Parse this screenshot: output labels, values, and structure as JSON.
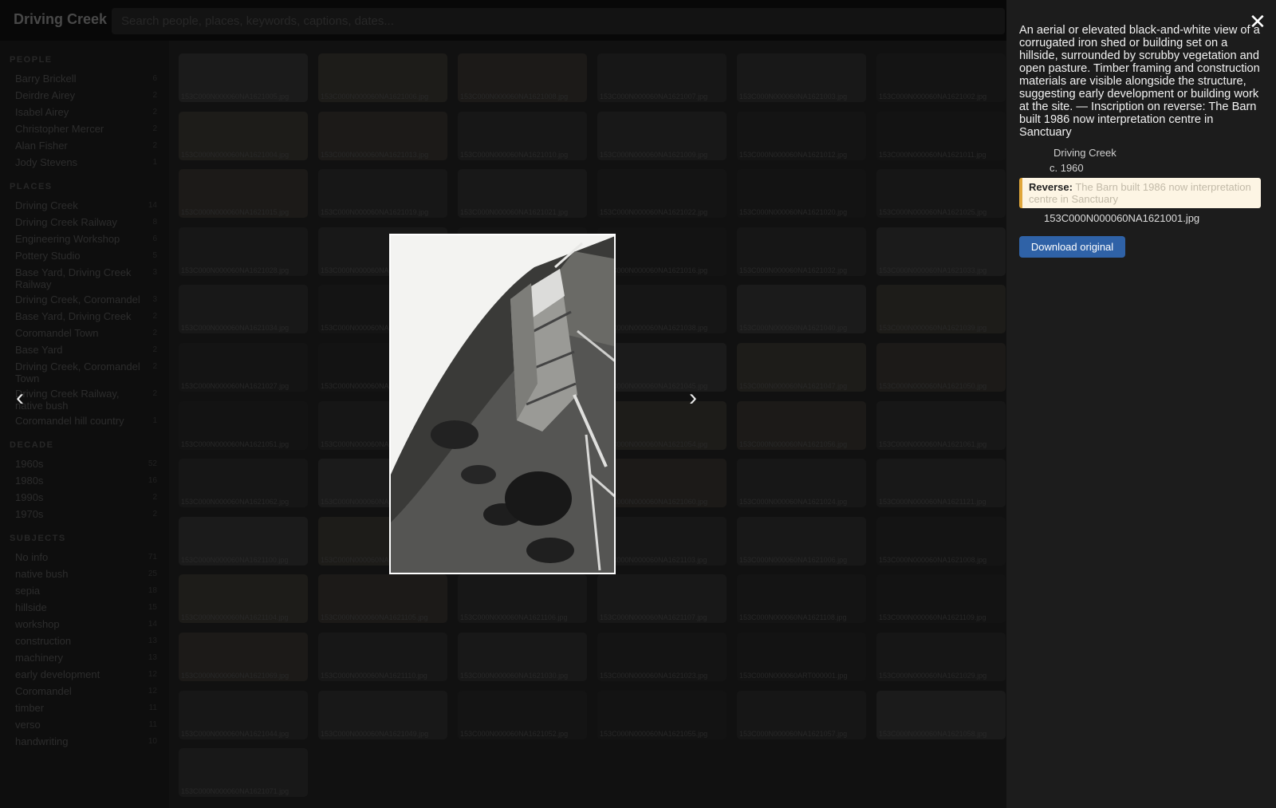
{
  "app": {
    "title": "Driving Creek"
  },
  "search": {
    "placeholder": "Search people, places, keywords, captions, dates..."
  },
  "sidebar": {
    "sections": [
      {
        "heading": "PEOPLE",
        "items": [
          {
            "label": "Barry Brickell",
            "count": "6"
          },
          {
            "label": "Deirdre Airey",
            "count": "2"
          },
          {
            "label": "Isabel Airey",
            "count": "2"
          },
          {
            "label": "Christopher Mercer",
            "count": "2"
          },
          {
            "label": "Alan Fisher",
            "count": "2"
          },
          {
            "label": "Jody Stevens",
            "count": "1"
          }
        ]
      },
      {
        "heading": "PLACES",
        "items": [
          {
            "label": "Driving Creek",
            "count": "14"
          },
          {
            "label": "Driving Creek Railway",
            "count": "8"
          },
          {
            "label": "Engineering Workshop",
            "count": "6"
          },
          {
            "label": "Pottery Studio",
            "count": "5"
          },
          {
            "label": "Base Yard, Driving Creek Railway",
            "count": "3"
          },
          {
            "label": "Driving Creek, Coromandel",
            "count": "3"
          },
          {
            "label": "Base Yard, Driving Creek",
            "count": "2"
          },
          {
            "label": "Coromandel Town",
            "count": "2"
          },
          {
            "label": "Base Yard",
            "count": "2"
          },
          {
            "label": "Driving Creek, Coromandel Town",
            "count": "2"
          },
          {
            "label": "Driving Creek Railway, native bush",
            "count": "2"
          },
          {
            "label": "Coromandel hill country",
            "count": "1"
          }
        ]
      },
      {
        "heading": "DECADE",
        "items": [
          {
            "label": "1960s",
            "count": "52"
          },
          {
            "label": "1980s",
            "count": "16"
          },
          {
            "label": "1990s",
            "count": "2"
          },
          {
            "label": "1970s",
            "count": "2"
          }
        ]
      },
      {
        "heading": "SUBJECTS",
        "items": [
          {
            "label": "No info",
            "count": "71"
          },
          {
            "label": "native bush",
            "count": "25"
          },
          {
            "label": "sepia",
            "count": "18"
          },
          {
            "label": "hillside",
            "count": "15"
          },
          {
            "label": "workshop",
            "count": "14"
          },
          {
            "label": "construction",
            "count": "13"
          },
          {
            "label": "machinery",
            "count": "13"
          },
          {
            "label": "early development",
            "count": "12"
          },
          {
            "label": "Coromandel",
            "count": "12"
          },
          {
            "label": "timber",
            "count": "11"
          },
          {
            "label": "verso",
            "count": "11"
          },
          {
            "label": "handwriting",
            "count": "10"
          }
        ]
      }
    ]
  },
  "grid": {
    "thumbnails": [
      "153C000N000060NA1621005.jpg",
      "153C000N000060NA1621006.jpg",
      "153C000N000060NA1621008.jpg",
      "153C000N000060NA1621007.jpg",
      "153C000N000060NA1621003.jpg",
      "153C000N000060NA1621002.jpg",
      "153C000N000060NA1621004.jpg",
      "153C000N000060NA1621013.jpg",
      "153C000N000060NA1621010.jpg",
      "153C000N000060NA1621009.jpg",
      "153C000N000060NA1621012.jpg",
      "153C000N000060NA1621011.jpg",
      "153C000N000060NA1621015.jpg",
      "153C000N000060NA1621019.jpg",
      "153C000N000060NA1621021.jpg",
      "153C000N000060NA1621022.jpg",
      "153C000N000060NA1621020.jpg",
      "153C000N000060NA1621025.jpg",
      "153C000N000060NA1621028.jpg",
      "153C000N000060NA1621014.jpg",
      "153C000N000060NA1621017.jpg",
      "153C000N000060NA1621016.jpg",
      "153C000N000060NA1621032.jpg",
      "153C000N000060NA1621033.jpg",
      "153C000N000060NA1621034.jpg",
      "153C000N000060NA1621036.jpg",
      "153C000N000060NA1621037.jpg",
      "153C000N000060NA1621038.jpg",
      "153C000N000060NA1621040.jpg",
      "153C000N000060NA1621039.jpg",
      "153C000N000060NA1621027.jpg",
      "153C000N000060NA1621043.jpg",
      "153C000N000060NA1621044.jpg",
      "153C000N000060NA1621045.jpg",
      "153C000N000060NA1621047.jpg",
      "153C000N000060NA1621050.jpg",
      "153C000N000060NA1621051.jpg",
      "153C000N000060NA1621052.jpg",
      "153C000N000060NA1621053.jpg",
      "153C000N000060NA1621054.jpg",
      "153C000N000060NA1621056.jpg",
      "153C000N000060NA1621061.jpg",
      "153C000N000060NA1621062.jpg",
      "153C000N000060NA1621063.jpg",
      "153C000N000060NA1621064.jpg",
      "153C000N000060NA1621060.jpg",
      "153C000N000060NA1621024.jpg",
      "153C000N000060NA1621121.jpg",
      "153C000N000060NA1621100.jpg",
      "153C000N000060NA1621101.jpg",
      "153C000N000060NA1621102.jpg",
      "153C000N000060NA1621103.jpg",
      "153C000N000060NA1621006.jpg",
      "153C000N000060NA1621008.jpg",
      "153C000N000060NA1621104.jpg",
      "153C000N000060NA1621105.jpg",
      "153C000N000060NA1621106.jpg",
      "153C000N000060NA1621107.jpg",
      "153C000N000060NA1621108.jpg",
      "153C000N000060NA1621109.jpg",
      "153C000N000060NA1621069.jpg",
      "153C000N000060NA1621110.jpg",
      "153C000N000060NA1621030.jpg",
      "153C000N000060NA1621023.jpg",
      "153C000N000060ART000001.jpg",
      "153C000N000060NA1621029.jpg",
      "153C000N000060NA1621044.jpg",
      "153C000N000060NA1621049.jpg",
      "153C000N000060NA1621052.jpg",
      "153C000N000060NA1621055.jpg",
      "153C000N000060NA1621057.jpg",
      "153C000N000060NA1621058.jpg",
      "153C000N000060NA1621071.jpg"
    ]
  },
  "lightbox": {
    "prev": "‹",
    "next": "›",
    "close": "✕",
    "description": "An aerial or elevated black-and-white view of a corrugated iron shed or building set on a hillside, surrounded by scrubby vegetation and open pasture. Timber framing and construction materials are visible alongside the structure, suggesting early development or building work at the site. — Inscription on reverse: The Barn built 1986 now interpretation centre in Sanctuary",
    "place": "Driving Creek",
    "date": "c. 1960",
    "reverse_label": "Reverse:",
    "reverse_text": "The Barn built 1986 now interpretation centre in Sanctuary",
    "filename": "153C000N000060NA1621001.jpg",
    "download_label": "Download original"
  },
  "colors": {
    "accent_button": "#2f62a7",
    "reverse_bar": "#e0a63a",
    "reverse_bg": "#fdf5e4"
  }
}
